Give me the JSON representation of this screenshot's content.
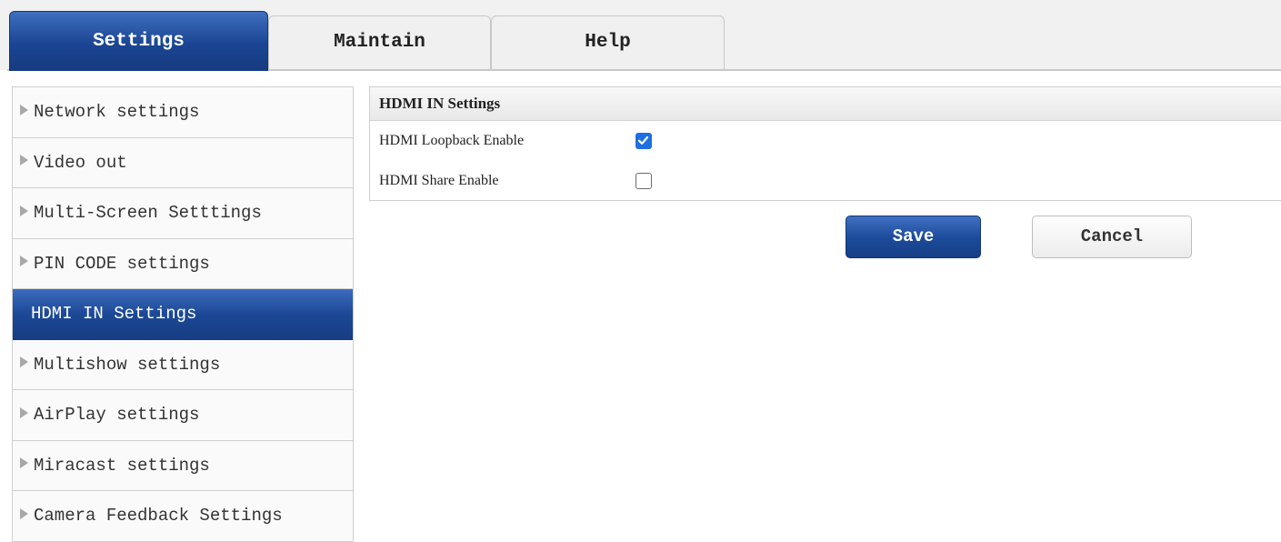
{
  "tabs": [
    {
      "label": "Settings",
      "active": true
    },
    {
      "label": "Maintain",
      "active": false
    },
    {
      "label": "Help",
      "active": false
    }
  ],
  "sidebar": {
    "items": [
      {
        "label": "Network settings",
        "active": false
      },
      {
        "label": "Video out",
        "active": false
      },
      {
        "label": "Multi-Screen Setttings",
        "active": false
      },
      {
        "label": "PIN CODE settings",
        "active": false
      },
      {
        "label": "HDMI IN Settings",
        "active": true
      },
      {
        "label": "Multishow settings",
        "active": false
      },
      {
        "label": "AirPlay settings",
        "active": false
      },
      {
        "label": "Miracast settings",
        "active": false
      },
      {
        "label": "Camera Feedback Settings",
        "active": false
      }
    ]
  },
  "panel": {
    "title": "HDMI IN Settings",
    "settings": [
      {
        "label": "HDMI Loopback Enable",
        "checked": true
      },
      {
        "label": "HDMI Share Enable",
        "checked": false
      }
    ]
  },
  "buttons": {
    "save_label": "Save",
    "cancel_label": "Cancel"
  },
  "colors": {
    "accent": "#1c4896",
    "checkbox_checked": "#1f6fe0"
  }
}
